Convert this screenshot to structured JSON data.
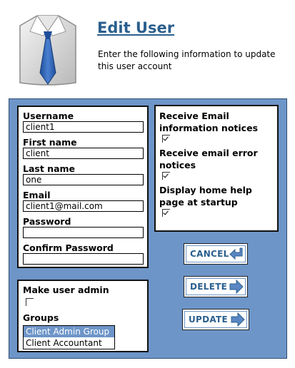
{
  "header": {
    "title": "Edit User",
    "subtitle": "Enter the following information to update this user account"
  },
  "user_form": {
    "username_label": "Username",
    "username_value": "client1",
    "firstname_label": "First name",
    "firstname_value": "client",
    "lastname_label": "Last name",
    "lastname_value": "one",
    "email_label": "Email",
    "email_value": "client1@mail.com",
    "password_label": "Password",
    "password_value": "",
    "confirm_label": "Confirm Password",
    "confirm_value": ""
  },
  "notifications": {
    "info_label": "Receive Email information notices",
    "info_checked": true,
    "error_label": "Receive email error notices",
    "error_checked": true,
    "help_label": "Display home help page at startup",
    "help_checked": true
  },
  "admin": {
    "admin_label": "Make user admin",
    "admin_checked": false,
    "groups_label": "Groups",
    "groups": [
      {
        "name": "Client Admin Group",
        "selected": true
      },
      {
        "name": "Client Accountant",
        "selected": false
      }
    ]
  },
  "buttons": {
    "cancel": "CANCEL",
    "delete": "DELETE",
    "update": "UPDATE"
  },
  "colors": {
    "panel_bg": "#6d95c8",
    "title": "#2b5f8e",
    "selected_bg": "#6d95c8"
  },
  "icons": {
    "header": "shirt-tie-icon",
    "cancel": "return-arrow-icon",
    "delete": "right-arrow-icon",
    "update": "right-arrow-icon"
  }
}
